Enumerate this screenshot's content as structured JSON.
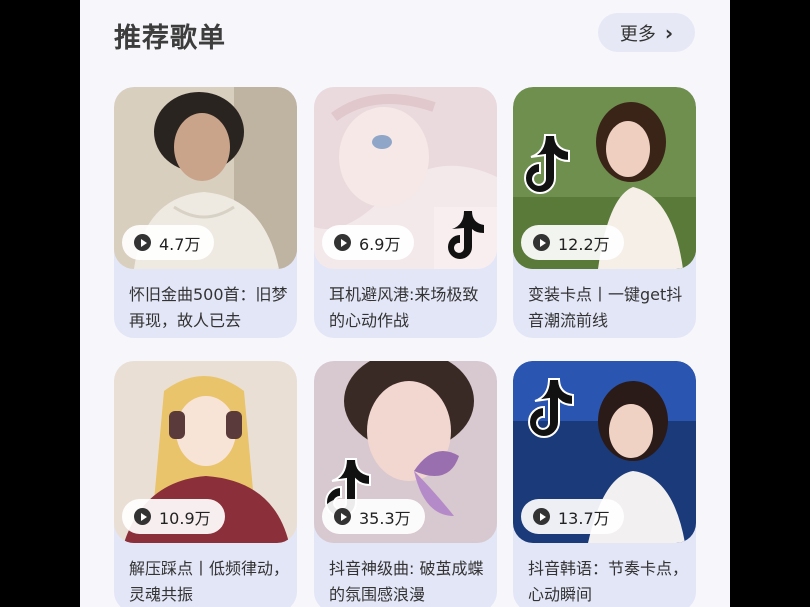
{
  "section": {
    "title": "推荐歌单",
    "more_label": "更多"
  },
  "colors": {
    "accent_bg": "#e6e8f5",
    "card_bg": "#e3e6f7"
  },
  "playlists": [
    {
      "plays": "4.7万",
      "title": "怀旧金曲500首：旧梦再现，故人已去",
      "cover": "vintage-portrait-cover"
    },
    {
      "plays": "6.9万",
      "title": "耳机避风港:来场极致的心动作战",
      "cover": "anime-girl-cover"
    },
    {
      "plays": "12.2万",
      "title": "变装卡点丨一键get抖音潮流前线",
      "cover": "tiktok-girl-cover"
    },
    {
      "plays": "10.9万",
      "title": "解压踩点丨低频律动，灵魂共振",
      "cover": "anime-headphones-cover"
    },
    {
      "plays": "35.3万",
      "title": "抖音神级曲: 破茧成蝶的氛围感浪漫",
      "cover": "butterfly-girl-cover"
    },
    {
      "plays": "13.7万",
      "title": "抖音韩语：节奏卡点，心动瞬间",
      "cover": "tiktok-singer-cover"
    }
  ]
}
